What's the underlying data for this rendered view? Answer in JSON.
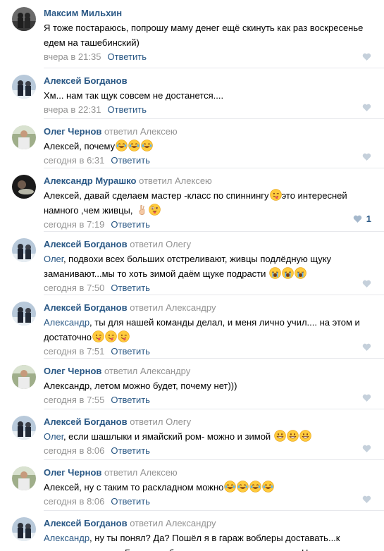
{
  "reply_label": "Ответить",
  "comments": [
    {
      "author": "Максим Мильхин",
      "reply_to": "",
      "mention": "",
      "text": "Я тоже постараюсь, попрошу маму денег ещё скинуть как раз воскресенье едем на ташебинский)",
      "emojis": [],
      "time": "вчера в 21:35",
      "likes": "",
      "avatar": "avatar-group-dark"
    },
    {
      "author": "Алексей Богданов",
      "reply_to": "",
      "mention": "",
      "text": "Хм... нам так щук совсем не достанется....",
      "emojis": [],
      "time": "вчера в 22:31",
      "likes": "",
      "avatar": "avatar-two-people-snow"
    },
    {
      "author": "Олег Чернов",
      "reply_to": "ответил Алексею",
      "mention": "",
      "text": "Алексей, почему",
      "emojis": [
        "laughing-tears",
        "laughing-tears",
        "laughing-tears"
      ],
      "time": "сегодня в 6:31",
      "likes": "",
      "avatar": "avatar-man-outdoors"
    },
    {
      "author": "Александр Мурашко",
      "reply_to": "ответил Алексею",
      "mention": "",
      "text": "Алексей, давай сделаем мастер -класс по спиннингу",
      "text_after": "это интересней намного ,чем живцы,",
      "emojis_mid": [
        "winking-tongue"
      ],
      "emojis": [
        "hand-gesture",
        "crazy-face"
      ],
      "time": "сегодня в 7:19",
      "likes": "1",
      "avatar": "avatar-man-fish"
    },
    {
      "author": "Алексей Богданов",
      "reply_to": "ответил Олегу",
      "mention": "Олег",
      "text": ", подвохи всех больших отстреливают, живцы подлёдную щуку заманивают...мы то хоть зимой даём щуке подрасти",
      "emojis": [
        "crying-loud",
        "crying-loud",
        "crying-loud"
      ],
      "time": "сегодня в 7:50",
      "likes": "",
      "avatar": "avatar-two-people-snow"
    },
    {
      "author": "Алексей Богданов",
      "reply_to": "ответил Александру",
      "mention": "Александр",
      "text": ", ты для нашей команды делал, и меня лично учил.... на этом и достаточно",
      "emojis": [
        "winking-tongue",
        "winking-tongue",
        "winking-tongue"
      ],
      "time": "сегодня в 7:51",
      "likes": "",
      "avatar": "avatar-two-people-snow"
    },
    {
      "author": "Олег Чернов",
      "reply_to": "ответил Александру",
      "mention": "",
      "text": "Александр, летом можно будет, почему нет)))",
      "emojis": [],
      "time": "сегодня в 7:55",
      "likes": "",
      "avatar": "avatar-man-outdoors"
    },
    {
      "author": "Алексей Богданов",
      "reply_to": "ответил Олегу",
      "mention": "Олег",
      "text": ", если шашлыки и ямайский ром- можно и зимой ",
      "emojis": [
        "grinning",
        "grinning",
        "grinning"
      ],
      "time": "сегодня в 8:06",
      "likes": "",
      "avatar": "avatar-two-people-snow"
    },
    {
      "author": "Олег Чернов",
      "reply_to": "ответил Алексею",
      "mention": "",
      "text": "Алексей, ну с таким то раскладном можно",
      "emojis": [
        "laughing-tears",
        "laughing-tears",
        "laughing-tears",
        "laughing-tears"
      ],
      "time": "сегодня в 8:06",
      "likes": "",
      "avatar": "avatar-man-outdoors"
    },
    {
      "author": "Алексей Богданов",
      "reply_to": "ответил Александру",
      "mention": "Александр",
      "text": ", ну ты понял? Да? Пошёл я в гараж воблеры доставать...к выходным должен Безменов бланки твичевые отправить из Н-ска....",
      "emojis": [],
      "time": "",
      "likes": "",
      "avatar": "avatar-two-people-snow"
    }
  ]
}
